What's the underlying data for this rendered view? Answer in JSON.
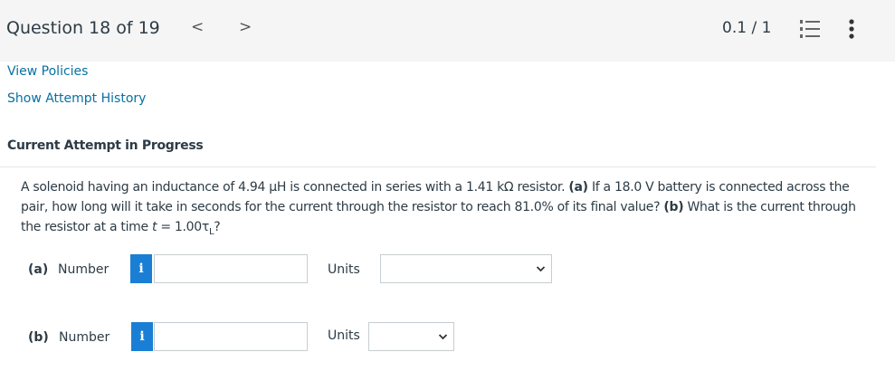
{
  "header": {
    "question_title": "Question 18 of 19",
    "prev_glyph": "<",
    "next_glyph": ">",
    "score": "0.1 / 1"
  },
  "links": {
    "view_policies": "View Policies",
    "show_attempt_history": "Show Attempt History"
  },
  "attempt": {
    "title": "Current Attempt in Progress"
  },
  "question": {
    "sentence1": "A solenoid having an inductance of 4.94 μH is connected in series with a 1.41 kΩ resistor.",
    "part_a_marker": "(a)",
    "part_a_text": "If a 18.0 V battery is connected across the pair, how long will it take in seconds for the current through the resistor to reach 81.0% of its final value?",
    "part_b_marker": "(b)",
    "part_b_text_1": "What is the current through the resistor at a time",
    "part_b_var": "t",
    "part_b_text_2": "= 1.00τ",
    "part_b_sub": "L",
    "part_b_text_3": "?"
  },
  "answers": {
    "a": {
      "part": "(a)",
      "label": "Number",
      "info_glyph": "i",
      "value": "",
      "units_label": "Units",
      "units_value": ""
    },
    "b": {
      "part": "(b)",
      "label": "Number",
      "info_glyph": "i",
      "value": "",
      "units_label": "Units",
      "units_value": ""
    }
  },
  "icons": {
    "list": "list-numbered-icon",
    "more": "more-vertical-icon",
    "chevron": "chevron-down-icon"
  },
  "colors": {
    "link": "#0770a3",
    "info_button": "#1a7fd4",
    "topbar_bg": "#f5f5f5"
  }
}
